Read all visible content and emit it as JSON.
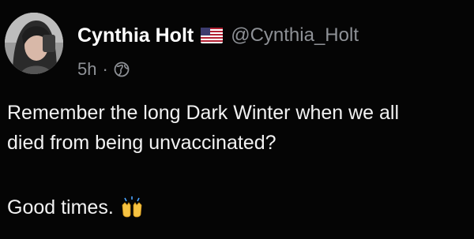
{
  "post": {
    "author": {
      "display_name": "Cynthia Holt",
      "handle": "@Cynthia_Holt",
      "badge_icon": "us-flag-icon",
      "avatar_icon": "avatar"
    },
    "meta": {
      "time": "5h",
      "separator": "·",
      "visibility_icon": "globe-icon"
    },
    "text_lines": [
      "Remember the long Dark Winter when we all",
      "died from being unvaccinated?"
    ],
    "closing": "Good times.",
    "closing_emoji_icon": "raised-hands-icon"
  },
  "colors": {
    "background": "#050505",
    "primary_text": "#ffffff",
    "secondary_text": "#8e9196"
  }
}
